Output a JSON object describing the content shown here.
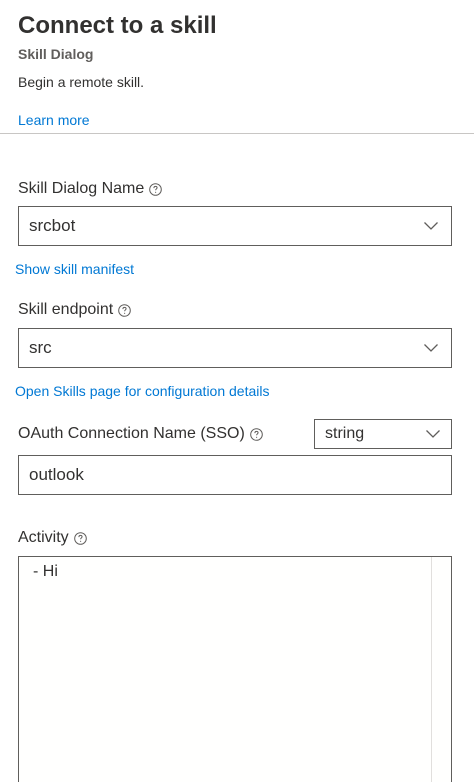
{
  "header": {
    "title": "Connect to a skill",
    "subtitle": "Skill Dialog",
    "description": "Begin a remote skill.",
    "learn_more": "Learn more"
  },
  "skill_dialog_name": {
    "label": "Skill Dialog Name",
    "value": "srcbot",
    "link": "Show skill manifest"
  },
  "skill_endpoint": {
    "label": "Skill endpoint",
    "value": "src",
    "link": "Open Skills page for configuration details"
  },
  "oauth": {
    "label": "OAuth Connection Name (SSO)",
    "type_value": "string",
    "value": "outlook"
  },
  "activity": {
    "label": "Activity",
    "lines": [
      "- Hi"
    ]
  },
  "colors": {
    "accent": "#0078d4",
    "text": "#323130",
    "border": "#605e5c"
  },
  "icons": {
    "info": "info-circle-icon",
    "dropdown": "chevron-down-icon"
  }
}
